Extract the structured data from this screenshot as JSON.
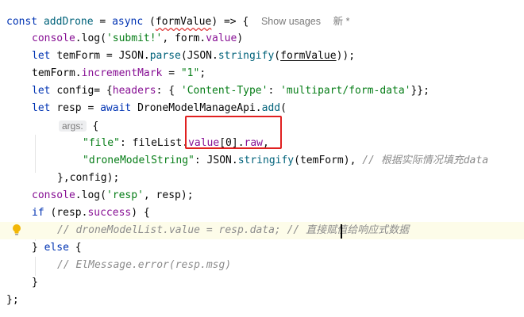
{
  "code": {
    "l1_const": "const ",
    "l1_fn": "addDrone",
    "l1_eq": " = ",
    "l1_async": "async",
    "l1_open": " (",
    "l1_param": "formValue",
    "l1_close": ") => {",
    "show_usages": "Show usages",
    "new_marker": "新 *",
    "l2_console": "console",
    "l2_log": ".log(",
    "l2_str": "'submit!'",
    "l2_form": ", form.",
    "l2_value": "value",
    "l2_end": ")",
    "l3_let": "let ",
    "l3_var": "temForm",
    "l3_json": " = JSON.",
    "l3_parse": "parse",
    "l3_json2": "(JSON.",
    "l3_stringify": "stringify",
    "l3_open": "(",
    "l3_param": "formValue",
    "l3_end": "));",
    "l4_var": "temForm",
    "l4_dot": ".",
    "l4_prop": "incrementMark",
    "l4_eq": " = ",
    "l4_str": "\"1\"",
    "l4_end": ";",
    "l5_let": "let ",
    "l5_var": "config",
    "l5_eq": "= {",
    "l5_headers": "headers",
    "l5_colon": ": { ",
    "l5_key": "'Content-Type'",
    "l5_colon2": ": ",
    "l5_val": "'multipart/form-data'",
    "l5_end": "}};",
    "l6_let": "let ",
    "l6_var": "resp",
    "l6_eq": " = ",
    "l6_await": "await",
    "l6_api": " DroneModelManageApi.",
    "l6_add": "add",
    "l6_open": "(",
    "l7_hint": "args:",
    "l7_brace": " {",
    "l8_key": "\"file\"",
    "l8_colon": ": ",
    "l8_list": "fileList",
    "l8_dot": ".",
    "l8_value": "value",
    "l8_idx": "[0].",
    "l8_raw": "raw",
    "l8_comma": ",",
    "l9_key": "\"droneModelString\"",
    "l9_colon": ": JSON.",
    "l9_stringify": "stringify",
    "l9_args": "(temForm), ",
    "l9_comment": "// 根据实际情况填充data",
    "l10_close": "},",
    "l10_config": "config",
    "l10_end": ");",
    "l11_console": "console",
    "l11_log": ".log(",
    "l11_str": "'resp'",
    "l11_end": ", resp);",
    "l12_if": "if ",
    "l12_open": "(resp.",
    "l12_success": "success",
    "l12_end": ") {",
    "l13_comment": "// droneModelList.value = resp.data; // 直接赋值给响应式数据",
    "l14_close": "} ",
    "l14_else": "else",
    "l14_brace": " {",
    "l15_comment": "// ElMessage.error(resp.msg)",
    "l16_close": "}",
    "l17_close": "};"
  },
  "colors": {
    "keyword": "#0033b3",
    "function": "#00627a",
    "property": "#871094",
    "string": "#067d17",
    "comment": "#8c8c8c",
    "highlight_box": "#e02020",
    "line_highlight": "#fdfce9"
  },
  "icons": {
    "gutter": "lightbulb-icon"
  }
}
